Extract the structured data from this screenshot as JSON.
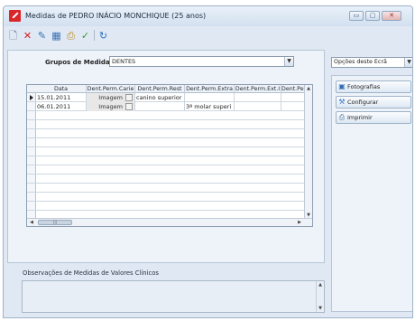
{
  "window": {
    "title": "Medidas de PEDRO INÁCIO MONCHIQUE (25 anos)",
    "controls": {
      "minimize": "▭",
      "maximize": "▢",
      "close": "✕"
    }
  },
  "toolbar": {
    "icons": [
      "new-document-icon",
      "delete-icon",
      "edit-icon",
      "save-icon",
      "print-icon",
      "tools-icon",
      "refresh-icon"
    ]
  },
  "groups": {
    "label": "Grupos de Medidas",
    "selected": "DENTES"
  },
  "grid": {
    "columns": [
      "Data",
      "Dent.Perm.Carie",
      "Dent.Perm.Rest",
      "Dent.Perm.Extra",
      "Dent.Perm.Ext.I",
      "Dent.Perm.In"
    ],
    "rows": [
      {
        "date": "15.01.2011",
        "imagem": "Imagem",
        "rest": "canino superior",
        "extra": "",
        "ext_i": "",
        "in": ""
      },
      {
        "date": "06.01.2011",
        "imagem": "Imagem",
        "rest": "",
        "extra": "3ª molar superi",
        "ext_i": "",
        "in": ""
      }
    ]
  },
  "observations": {
    "label": "Observações de Medidas de Valores Clínicos"
  },
  "options": {
    "selected": "Opções deste Ecrã"
  },
  "side_buttons": [
    {
      "label": "Fotografias",
      "icon": "photos-icon"
    },
    {
      "label": "Configurar",
      "icon": "configure-icon"
    },
    {
      "label": "Imprimir",
      "icon": "print-icon"
    }
  ],
  "colors": {
    "accent": "#d8262a",
    "window_bg": "#dfe8f3"
  }
}
